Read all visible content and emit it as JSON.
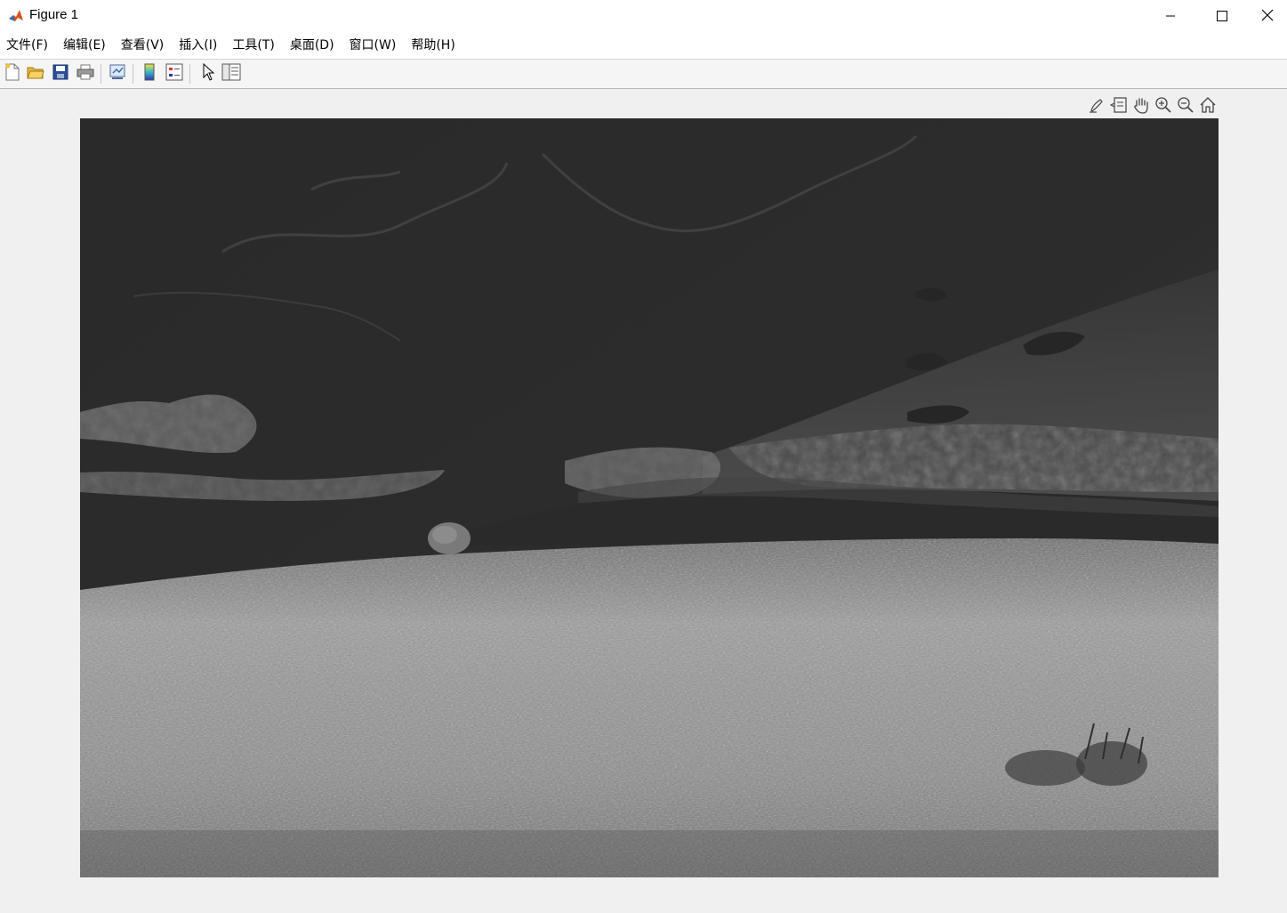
{
  "window": {
    "title": "Figure 1",
    "app_icon": "matlab-icon",
    "controls": [
      "minimize-icon",
      "maximize-icon",
      "close-icon"
    ]
  },
  "menu": {
    "items": [
      {
        "label": "文件(F)"
      },
      {
        "label": "编辑(E)"
      },
      {
        "label": "查看(V)"
      },
      {
        "label": "插入(I)"
      },
      {
        "label": "工具(T)"
      },
      {
        "label": "桌面(D)"
      },
      {
        "label": "窗口(W)"
      },
      {
        "label": "帮助(H)"
      }
    ]
  },
  "toolbar": {
    "buttons": [
      "new-figure-icon",
      "open-file-icon",
      "save-icon",
      "print-icon",
      "link-plot-icon",
      "colorbar-icon",
      "legend-icon",
      "edit-plot-arrow-icon",
      "property-inspector-icon"
    ]
  },
  "axes_toolbar": {
    "buttons": [
      "brush-icon",
      "data-tips-icon",
      "pan-hand-icon",
      "zoom-in-icon",
      "zoom-out-icon",
      "restore-view-home-icon"
    ]
  },
  "image": {
    "description_colors": {
      "sky": "#2b2b2b",
      "cloud": "#6e6e6e",
      "grass": "#8a8a8a"
    }
  }
}
